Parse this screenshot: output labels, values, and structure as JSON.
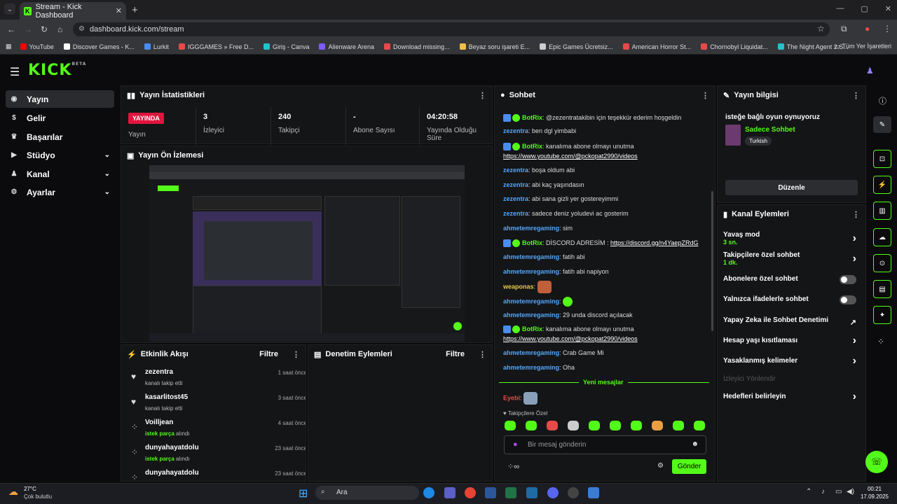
{
  "browser": {
    "tab_title": "Stream - Kick Dashboard",
    "url": "dashboard.kick.com/stream",
    "window_time": "",
    "bookmarks": [
      {
        "label": "YouTube",
        "color": "#ff0000"
      },
      {
        "label": "Discover Games - K...",
        "color": "#ffffff"
      },
      {
        "label": "Lurkit",
        "color": "#4a8cf0"
      },
      {
        "label": "IGGGAMES » Free D...",
        "color": "#e84a4a"
      },
      {
        "label": "Giriş - Canva",
        "color": "#20c4cb"
      },
      {
        "label": "Alienware Arena",
        "color": "#7b5cff"
      },
      {
        "label": "Download missing...",
        "color": "#e84a4a"
      },
      {
        "label": "Beyaz soru işareti E...",
        "color": "#f0c040"
      },
      {
        "label": "Epic Games Ücretsiz...",
        "color": "#cccccc"
      },
      {
        "label": "American Horror St...",
        "color": "#e84a4a"
      },
      {
        "label": "Chornobyl Liquidat...",
        "color": "#e84a4a"
      },
      {
        "label": "The Night Agent 2.S...",
        "color": "#20c4cb"
      }
    ],
    "all_bookmarks": "Tüm Yer İşaretleri"
  },
  "brand": {
    "logo": "KICK",
    "beta": "BETA"
  },
  "sidebar": {
    "items": [
      {
        "label": "Yayın",
        "icon": "broadcast-icon"
      },
      {
        "label": "Gelir",
        "icon": "money-icon"
      },
      {
        "label": "Başarılar",
        "icon": "trophy-icon"
      },
      {
        "label": "Stüdyo",
        "icon": "studio-icon"
      },
      {
        "label": "Kanal",
        "icon": "user-icon"
      },
      {
        "label": "Ayarlar",
        "icon": "gear-icon"
      }
    ]
  },
  "stats": {
    "title": "Yayın İstatistikleri",
    "live_badge": "YAYINDA",
    "items": [
      {
        "value": "",
        "label": "Yayın"
      },
      {
        "value": "3",
        "label": "İzleyici"
      },
      {
        "value": "240",
        "label": "Takipçi"
      },
      {
        "value": "-",
        "label": "Abone Sayısı"
      },
      {
        "value": "04:20:58",
        "label": "Yayında Olduğu Süre"
      }
    ]
  },
  "preview": {
    "title": "Yayın Ön İzlemesi"
  },
  "activity": {
    "title": "Etkinlik Akışı",
    "filter": "Filtre",
    "items": [
      {
        "name": "zezentra",
        "desc": "kanalı takip etti",
        "time": "1 saat önce",
        "icon": "heart-icon",
        "highlight": ""
      },
      {
        "name": "kasarlitost45",
        "desc": "kanalı takip etti",
        "time": "3 saat önce",
        "icon": "heart-icon",
        "highlight": ""
      },
      {
        "name": "Voilljean",
        "desc": "alındı",
        "time": "4 saat önce",
        "icon": "kick-icon",
        "highlight": "istek parça"
      },
      {
        "name": "dunyahayatdolu",
        "desc": "alındı",
        "time": "23 saat önce",
        "icon": "kick-icon",
        "highlight": "istek parça"
      },
      {
        "name": "dunyahayatdolu",
        "desc": "",
        "time": "23 saat önce",
        "icon": "kick-icon",
        "highlight": ""
      }
    ]
  },
  "moderation": {
    "title": "Denetim Eylemleri",
    "filter": "Filtre"
  },
  "chat": {
    "title": "Sohbet",
    "new_messages": "Yeni mesajlar",
    "follower_only": "Takipçilere Özel",
    "input_placeholder": "Bir mesaj gönderin",
    "send": "Gönder",
    "messages": [
      {
        "user": "BotRix",
        "bot": true,
        "text": "@zezentratakibin için teşekkür ederim hoşgeldin",
        "link": ""
      },
      {
        "user": "zezentra",
        "text": "ben dgl yimbabi"
      },
      {
        "user": "BotRix",
        "bot": true,
        "text": "kanalıma abone olmayı unutma",
        "link": "https://www.youtube.com/@pckopat2990/videos"
      },
      {
        "user": "zezentra",
        "text": "boşa oldum abi"
      },
      {
        "user": "zezentra",
        "text": "abi kaç yaşındasın"
      },
      {
        "user": "zezentra",
        "text": "abi sana gizli yer gostereyimmi"
      },
      {
        "user": "zezentra",
        "text": "sadece deniz yoludevi ac gosterim"
      },
      {
        "user": "ahmetemregaming",
        "text": "sim"
      },
      {
        "user": "BotRix",
        "bot": true,
        "text": "DİSCORD ADRESİM :",
        "link": "https://discord.gg/n4YaepZRdG"
      },
      {
        "user": "ahmetemregaming",
        "text": "fatih abi"
      },
      {
        "user": "ahmetemregaming",
        "text": "fatih abi napiyon"
      },
      {
        "user": "weaponas",
        "text": ""
      },
      {
        "user": "ahmetemregaming",
        "text": ""
      },
      {
        "user": "ahmetemregaming",
        "text": "29 unda discord açılacak"
      },
      {
        "user": "BotRix",
        "bot": true,
        "text": "kanalıma abone olmayı unutma",
        "link": "https://www.youtube.com/@pckopat2990/videos"
      },
      {
        "user": "ahmetemregaming",
        "text": "Crab Game Mi"
      },
      {
        "user": "ahmetemregaming",
        "text": "Oha"
      },
      {
        "user": "Eyebi",
        "text": ""
      }
    ]
  },
  "stream_info": {
    "title": "Yayın bilgisi",
    "stream_title": "isteğe bağlı oyun oynuyoruz",
    "category": "Sadece Sohbet",
    "tag": "Turkish",
    "edit": "Düzenle"
  },
  "channel_actions": {
    "title": "Kanal Eylemleri",
    "items": [
      {
        "label": "Yavaş mod",
        "sub": "3 sn.",
        "type": "arrow"
      },
      {
        "label": "Takipçilere özel sohbet",
        "sub": "1 dk.",
        "type": "arrow"
      },
      {
        "label": "Abonelere özel sohbet",
        "sub": "",
        "type": "toggle"
      },
      {
        "label": "Yalnızca ifadelerle sohbet",
        "sub": "",
        "type": "toggle"
      },
      {
        "label": "Yapay Zeka ile Sohbet Denetimi",
        "sub": "",
        "type": "external"
      },
      {
        "label": "Hesap yaşı kısıtlaması",
        "sub": "",
        "type": "arrow"
      },
      {
        "label": "Yasaklanmış kelimeler",
        "sub": "",
        "type": "arrow"
      },
      {
        "label": "İzleyici Yönlendir",
        "sub": "",
        "type": "disabled"
      },
      {
        "label": "Hedefleri belirleyin",
        "sub": "",
        "type": "arrow"
      }
    ]
  },
  "taskbar": {
    "weather_temp": "27°C",
    "weather_desc": "Çok bulutlu",
    "search": "Ara",
    "time": "00:21",
    "date": "17.09.2025"
  },
  "colors": {
    "accent": "#53fc18",
    "live": "#e0153e",
    "bg": "#0b0b0d",
    "panel": "#141517"
  }
}
